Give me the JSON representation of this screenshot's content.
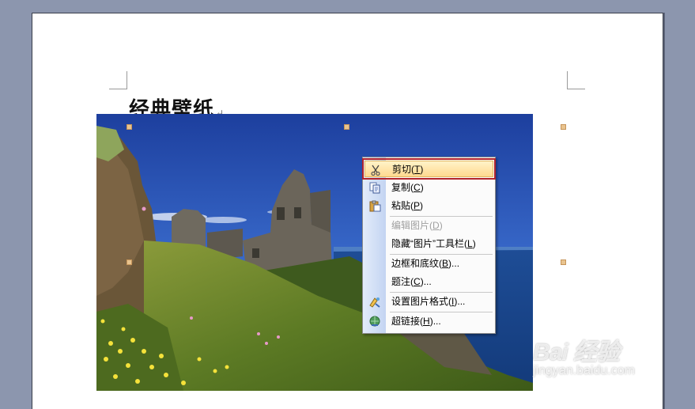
{
  "document": {
    "title": "经典壁纸",
    "paragraph_mark": "↵"
  },
  "context_menu": {
    "items": [
      {
        "label": "剪切",
        "accel": "T",
        "icon": "scissors-icon",
        "state": "selected"
      },
      {
        "label": "复制",
        "accel": "C",
        "icon": "copy-icon",
        "state": "normal"
      },
      {
        "label": "粘贴",
        "accel": "P",
        "icon": "paste-icon",
        "state": "normal"
      },
      {
        "label": "编辑图片",
        "accel": "D",
        "icon": "",
        "state": "disabled"
      },
      {
        "label": "隐藏“图片”工具栏",
        "accel": "L",
        "icon": "",
        "state": "normal"
      },
      {
        "label": "边框和底纹",
        "accel": "B",
        "suffix": "...",
        "icon": "",
        "state": "normal"
      },
      {
        "label": "题注",
        "accel": "C",
        "suffix": "...",
        "icon": "",
        "state": "normal"
      },
      {
        "label": "设置图片格式",
        "accel": "I",
        "suffix": "...",
        "icon": "format-picture-icon",
        "state": "normal"
      },
      {
        "label": "超链接",
        "accel": "H",
        "suffix": "...",
        "icon": "hyperlink-icon",
        "state": "normal"
      }
    ]
  },
  "watermark": {
    "logo": "Bai 经验",
    "url": "jingyan.baidu.com"
  },
  "colors": {
    "desktop_bg": "#8c96ae",
    "menu_highlight": "#ffd98f",
    "selection_outline": "#b3242b",
    "menu_rail": "#c3d4f2"
  }
}
